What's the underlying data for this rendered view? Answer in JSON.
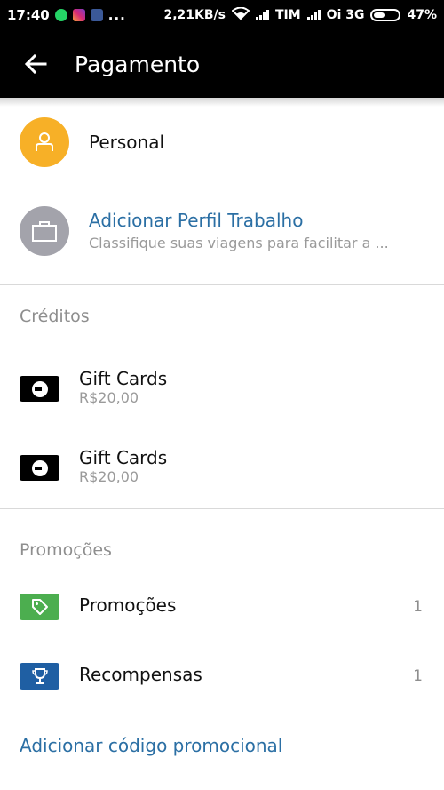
{
  "status_bar": {
    "time": "17:40",
    "more": "...",
    "speed": "2,21KB/s",
    "carrier1": "TIM",
    "carrier2": "Oi 3G",
    "battery": "47%"
  },
  "header": {
    "title": "Pagamento"
  },
  "profiles": [
    {
      "title": "Personal",
      "subtitle": ""
    },
    {
      "title": "Adicionar Perfil Trabalho",
      "subtitle": "Classifique suas viagens para facilitar a ..."
    }
  ],
  "credits": {
    "heading": "Créditos",
    "items": [
      {
        "title": "Gift Cards",
        "amount": "R$20,00"
      },
      {
        "title": "Gift Cards",
        "amount": "R$20,00"
      }
    ]
  },
  "promos": {
    "heading": "Promoções",
    "items": [
      {
        "title": "Promoções",
        "count": "1"
      },
      {
        "title": "Recompensas",
        "count": "1"
      }
    ],
    "add_code": "Adicionar código promocional"
  },
  "colors": {
    "personal_avatar": "#f7b027",
    "work_avatar": "#a3a3ab",
    "promo_icon": "#4cae4f",
    "reward_icon": "#1f5fa3",
    "link": "#2b6fa4"
  }
}
